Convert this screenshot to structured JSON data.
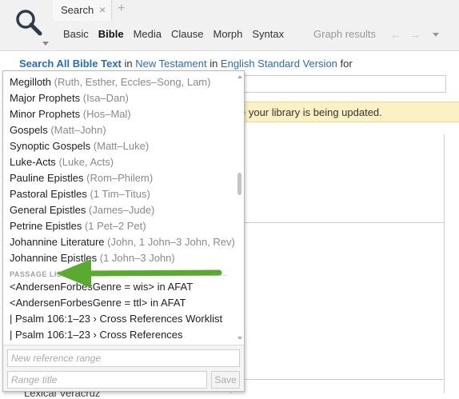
{
  "toolbar": {
    "tab_label": "Search",
    "tab_close": "×",
    "tab_add": "+",
    "search_types": [
      "Basic",
      "Bible",
      "Media",
      "Clause",
      "Morph",
      "Syntax"
    ],
    "active_type": "Bible",
    "graph_results": "Graph results",
    "back_arrow": "←",
    "forward_arrow": "→"
  },
  "query": {
    "part1": "Search All Bible Text",
    "in1": " in ",
    "part2": "New Testament",
    "in2": " in ",
    "part3": "English Standard Version",
    "for": " for"
  },
  "banner": {
    "text": "e your library is being updated."
  },
  "peek_text": "Lexical Veracruz",
  "dropdown": {
    "items": [
      {
        "name": "Megilloth",
        "ref": "(Ruth, Esther, Eccles–Song, Lam)"
      },
      {
        "name": "Major Prophets",
        "ref": "(Isa–Dan)"
      },
      {
        "name": "Minor Prophets",
        "ref": "(Hos–Mal)"
      },
      {
        "name": "Gospels",
        "ref": "(Matt–John)"
      },
      {
        "name": "Synoptic Gospels",
        "ref": "(Matt–Luke)"
      },
      {
        "name": "Luke-Acts",
        "ref": "(Luke, Acts)"
      },
      {
        "name": "Pauline Epistles",
        "ref": "(Rom–Philem)"
      },
      {
        "name": "Pastoral Epistles",
        "ref": "(1 Tim–Titus)"
      },
      {
        "name": "General Epistles",
        "ref": "(James–Jude)"
      },
      {
        "name": "Petrine Epistles",
        "ref": "(1 Pet–2 Pet)"
      },
      {
        "name": "Johannine Literature",
        "ref": "(John, 1 John–3 John, Rev)"
      },
      {
        "name": "Johannine Epistles",
        "ref": "(1 John–3 John)"
      }
    ],
    "section_label": "PASSAGE LISTS",
    "passage_lists": [
      "<AndersenForbesGenre = wis> in AFAT",
      "<AndersenForbesGenre = ttl> in AFAT",
      "| Psalm 106:1–23 › Cross References Worklist",
      "| Psalm 106:1–23 › Cross References"
    ],
    "reference_placeholder": "New reference range",
    "title_placeholder": "Range title",
    "save_label": "Save"
  },
  "colors": {
    "link": "#2a6db4",
    "banner_bg": "#fcf1c4",
    "annotation_arrow": "#5aaa32"
  }
}
